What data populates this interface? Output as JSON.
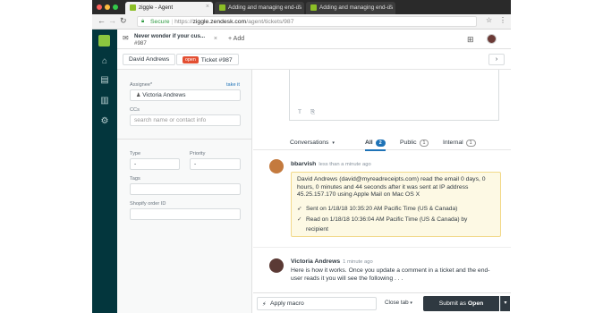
{
  "browser": {
    "tabs": [
      {
        "label": "ziggle - Agent",
        "active": true
      },
      {
        "label": "Adding and managing end-us",
        "active": false
      },
      {
        "label": "Adding and managing end-us",
        "active": false
      }
    ],
    "secure_label": "Secure",
    "url_scheme": "https://",
    "url_domain": "ziggle.zendesk.com",
    "url_path": "/agent/tickets/987"
  },
  "workspace": {
    "ticket_tab_title": "Never wonder if your cus...",
    "ticket_tab_sub": "#987",
    "add_label": "+ Add"
  },
  "breadcrumb": {
    "requester": "David Andrews",
    "status": "open",
    "ticket": "Ticket #987",
    "next": "›"
  },
  "properties": {
    "assignee_label": "Assignee*",
    "take_it": "take it",
    "assignee_value": "Victoria Andrews",
    "ccs_label": "CCs",
    "ccs_placeholder": "search name or contact info",
    "type_label": "Type",
    "type_value": "-",
    "priority_label": "Priority",
    "priority_value": "-",
    "tags_label": "Tags",
    "tags_value": "",
    "shopify_label": "Shopify order ID",
    "shopify_value": ""
  },
  "conversation": {
    "tabs": [
      {
        "label": "Conversations",
        "count": null
      },
      {
        "label": "All",
        "count": "2"
      },
      {
        "label": "Public",
        "count": "1"
      },
      {
        "label": "Internal",
        "count": "1"
      }
    ],
    "first": {
      "author": "bbarvish",
      "time": "less than a minute ago",
      "text": "David Andrews (david@myreadreceipts.com) read the email 0 days, 0 hours, 0 minutes and 44 seconds after it was sent at IP address 45.25.157.170 using Apple Mail on Mac OS X",
      "sent": "Sent on 1/18/18 10:35:20 AM Pacific Time (US & Canada)",
      "read": "Read on 1/18/18 10:36:04 AM Pacific Time (US & Canada) by",
      "read_cont": "recipient"
    },
    "second": {
      "author": "Victoria Andrews",
      "time": "1 minute ago",
      "text": "Here is how it works. Once you update a comment in a ticket and the end-user reads it you will see the following . . ."
    }
  },
  "footer": {
    "macro": "Apply macro",
    "close_tab": "Close tab",
    "submit_prefix": "Submit as",
    "submit_status": "Open"
  },
  "colors": {
    "nav_bg": "#03363d",
    "brand": "#8bc53f",
    "open_badge": "#e34f32",
    "accent": "#1f73b7"
  }
}
